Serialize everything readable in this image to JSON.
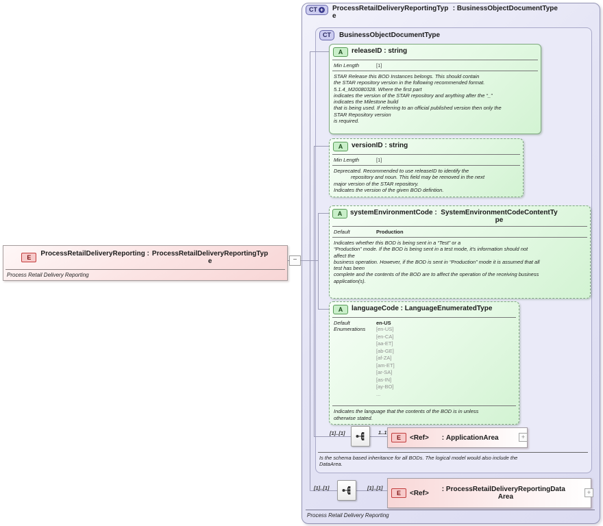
{
  "icons": {
    "element": "E",
    "attribute": "A",
    "complex_type": "CT",
    "derived_plus": "+",
    "collapse": "−",
    "expand": "+"
  },
  "root_element": {
    "name": "ProcessRetailDeliveryReporting",
    "type": "ProcessRetailDeliveryReportingType",
    "annotation": "Process Retail Delivery Reporting"
  },
  "outer_type": {
    "name": "ProcessRetailDeliveryReportingType",
    "base": "BusinessObjectDocumentType",
    "annotation": "Process Retail Delivery Reporting"
  },
  "inner_type": {
    "name": "BusinessObjectDocumentType",
    "annotation_lines": [
      "Is the schema based inheritance for all BODs. The logical model would also include the",
      "DataArea."
    ]
  },
  "attributes": [
    {
      "name": "releaseID",
      "type": "string",
      "facet_label": "Min Length",
      "facet_value": "[1]",
      "annotation_lines": [
        "STAR Release this BOD Instances belongs. This should contain",
        "the STAR repository version in the following recommended format.",
        "5.1.4_M20080328. Where the first part",
        "indicates the version of the STAR repository and anything after the “_”",
        "indicates the Milestone build",
        "that is being used. If referring to an official published version then only the",
        "STAR Repository version",
        "is required."
      ]
    },
    {
      "name": "versionID",
      "type": "string",
      "facet_label": "Min Length",
      "facet_value": "[1]",
      "annotation_lines": [
        "Deprecated. Recommended to use releaseID to identify the",
        "            repository and noun. This field may be removed in the next",
        "major version of the STAR repository.",
        "Indicates the version of the given BOD defintion."
      ]
    },
    {
      "name": "systemEnvironmentCode",
      "type": "SystemEnvironmentCodeContentType",
      "facet_label": "Default",
      "facet_value": "Production",
      "annotation_lines": [
        "Indicates whether this BOD is being sent in a “Test” or a",
        "“Production” mode. If the BOD is being sent in a test mode, it's information should not",
        "affect the",
        "business operation. However, if the BOD is sent in “Production” mode it is assumed that all",
        "test has been",
        "complete and the contents of the BOD are to affect the operation of the receiving business",
        "application(s)."
      ]
    },
    {
      "name": "languageCode",
      "type": "LanguageEnumeratedType",
      "default_label": "Default",
      "default_value": "en-US",
      "enumerations_label": "Enumerations",
      "enumerations": [
        "[en-US]",
        "[en-CA]",
        "[aa-ET]",
        "[ab-GE]",
        "[af-ZA]",
        "[am-ET]",
        "[ar-SA]",
        "[as-IN]",
        "[ay-BO]",
        "..."
      ],
      "annotation_lines": [
        "Indicates the language that the contents of the BOD is in unless",
        "otherwise stated."
      ]
    }
  ],
  "child_elements": [
    {
      "cardinality_left": "[1]..[1]",
      "cardinality_right": "1..1",
      "ref": "<Ref>",
      "type": "ApplicationArea"
    },
    {
      "cardinality_left": "[1]..[1]",
      "cardinality_right": "[1]..[1]",
      "ref": "<Ref>",
      "type": "ProcessRetailDeliveryReportingDataArea"
    }
  ]
}
